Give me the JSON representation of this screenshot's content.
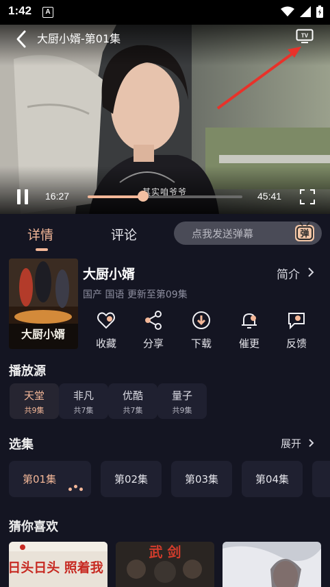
{
  "status": {
    "time": "1:42",
    "app_badge": "A"
  },
  "player": {
    "title": "大厨小婿-第01集",
    "current_time": "16:27",
    "duration": "45:41",
    "progress": 0.36,
    "subtitle": "其实咱爷爷",
    "accent": "#f3b798"
  },
  "tabs": [
    {
      "label": "详情"
    },
    {
      "label": "评论"
    }
  ],
  "danmaku": {
    "placeholder": "点我发送弹幕",
    "badge": "弹"
  },
  "show": {
    "title": "大厨小婿",
    "meta": "国产 国语 更新至第09集",
    "intro_label": "简介"
  },
  "actions": [
    {
      "label": "收藏",
      "icon": "heart-icon"
    },
    {
      "label": "分享",
      "icon": "share-icon"
    },
    {
      "label": "下载",
      "icon": "download-icon"
    },
    {
      "label": "催更",
      "icon": "bell-icon"
    },
    {
      "label": "反馈",
      "icon": "feedback-icon"
    }
  ],
  "sources_title": "播放源",
  "sources": [
    {
      "name": "天堂",
      "count": "共9集"
    },
    {
      "name": "非凡",
      "count": "共7集"
    },
    {
      "name": "优酷",
      "count": "共7集"
    },
    {
      "name": "量子",
      "count": "共9集"
    }
  ],
  "episodes_title": "选集",
  "expand_label": "展开",
  "episodes": [
    {
      "label": "第01集"
    },
    {
      "label": "第02集"
    },
    {
      "label": "第03集"
    },
    {
      "label": "第04集"
    }
  ],
  "recommend_title": "猜你喜欢",
  "recommend_texts": {
    "r1": "日头日头 照着我",
    "r2": "武 剑"
  }
}
